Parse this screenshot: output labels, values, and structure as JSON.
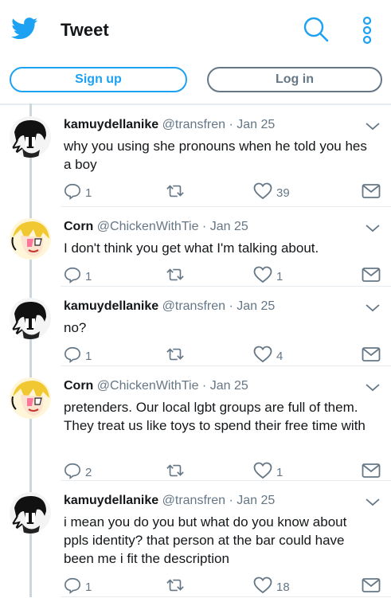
{
  "header": {
    "title": "Tweet",
    "icons": {
      "logo": "bird-icon",
      "search": "search-icon",
      "more": "more-icon"
    },
    "accent": "#1da1f2"
  },
  "auth": {
    "signup_label": "Sign up",
    "login_label": "Log in"
  },
  "tweets": [
    {
      "name": "kamuydellanike",
      "handle": "@transfren",
      "date": "· Jan 25",
      "text": "why you using she pronouns when he told you hes a boy",
      "replies": "1",
      "retweets": "",
      "likes": "39"
    },
    {
      "name": "Corn",
      "handle": "@ChickenWithTie",
      "date": "· Jan 25",
      "text": "I don't think you get what I'm talking about.",
      "replies": "1",
      "retweets": "",
      "likes": "1"
    },
    {
      "name": "kamuydellanike",
      "handle": "@transfren",
      "date": "· Jan 25",
      "text": "no?",
      "replies": "1",
      "retweets": "",
      "likes": "4"
    },
    {
      "name": "Corn",
      "handle": "@ChickenWithTie",
      "date": "· Jan 25",
      "text": "pretenders. Our local lgbt groups are full of them. They treat us like toys to spend their free time with",
      "replies": "2",
      "retweets": "",
      "likes": "1"
    },
    {
      "name": "kamuydellanike",
      "handle": "@transfren",
      "date": "· Jan 25",
      "text": "i mean you do you but what do you know about ppls identity? that person at the bar could have been me i fit the description",
      "replies": "1",
      "retweets": "",
      "likes": "18"
    }
  ]
}
